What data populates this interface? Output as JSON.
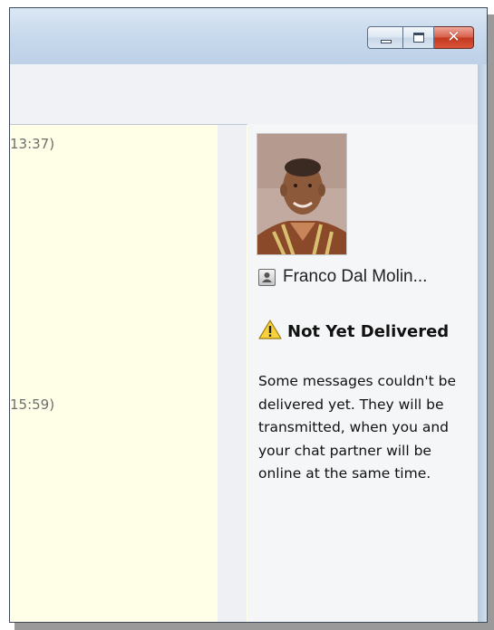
{
  "window": {
    "caption_buttons": [
      {
        "name": "minimize",
        "glyph": ""
      },
      {
        "name": "maximize",
        "glyph": ""
      },
      {
        "name": "close",
        "glyph": "✕"
      }
    ]
  },
  "chat": {
    "timestamps": [
      "13:37)",
      "15:59)"
    ]
  },
  "contact": {
    "name": "Franco Dal Molin...",
    "icon": "contact-card-icon"
  },
  "delivery_status": {
    "icon": "warning-icon",
    "title": "Not Yet Delivered",
    "message": "Some messages couldn't be delivered yet. They will be transmitted, when you and your chat partner will be online at the same time."
  },
  "colors": {
    "chat_background": "#ffffe8",
    "close_button": "#c2391f",
    "titlebar": "#c7d9ec"
  }
}
